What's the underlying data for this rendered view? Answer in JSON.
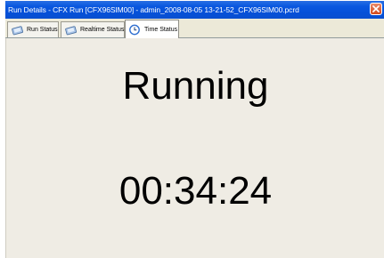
{
  "window": {
    "title": "Run Details - CFX Run [CFX96SIM00] - admin_2008-08-05 13-21-52_CFX96SIM00.pcrd"
  },
  "tabs": [
    {
      "label": "Run Status",
      "icon": "run-status-icon",
      "active": false
    },
    {
      "label": "Realtime Status",
      "icon": "realtime-status-icon",
      "active": false
    },
    {
      "label": "Time Status",
      "icon": "clock-icon",
      "active": true
    }
  ],
  "content": {
    "status": "Running",
    "elapsed_time": "00:34:24"
  },
  "colors": {
    "titlebar": "#0a58e0",
    "background": "#ece9d8",
    "close_button": "#d44a1c"
  }
}
